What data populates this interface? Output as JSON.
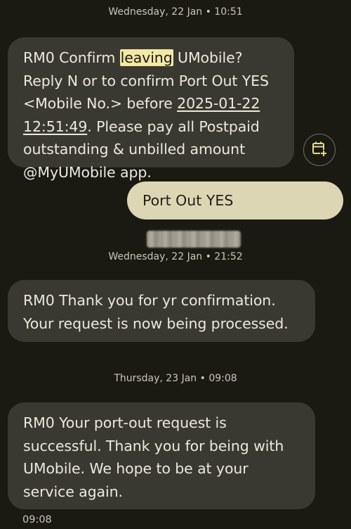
{
  "conversation": {
    "date_1": "Wednesday, 22 Jan • 10:51",
    "date_2": "Wednesday, 22 Jan • 21:52",
    "date_3": "Thursday, 23 Jan • 09:08",
    "msg1": {
      "part1": "RM0 Confirm ",
      "highlight": "leaving",
      "part2": " UMobile? Reply N or to confirm Port Out YES <Mobile No.> before ",
      "date_link": "2025-01-22 12:51:49",
      "part3": ". Please pay all Postpaid outstanding & unbilled amount @MyUMobile app."
    },
    "sent_msg": "Port Out YES",
    "msg2": "RM0 Thank you for yr confirmation. Your request is now being processed.",
    "msg3": "RM0 Your port-out request is successful. Thank you for being with UMobile. We hope to be at your service again.",
    "msg3_time": "09:08"
  },
  "icons": {
    "calendar": "calendar-add-icon"
  },
  "colors": {
    "background": "#1b1a12",
    "received_bubble": "#3a3931",
    "sent_bubble": "#ddd6b4",
    "highlight": "#f3e8a4"
  }
}
